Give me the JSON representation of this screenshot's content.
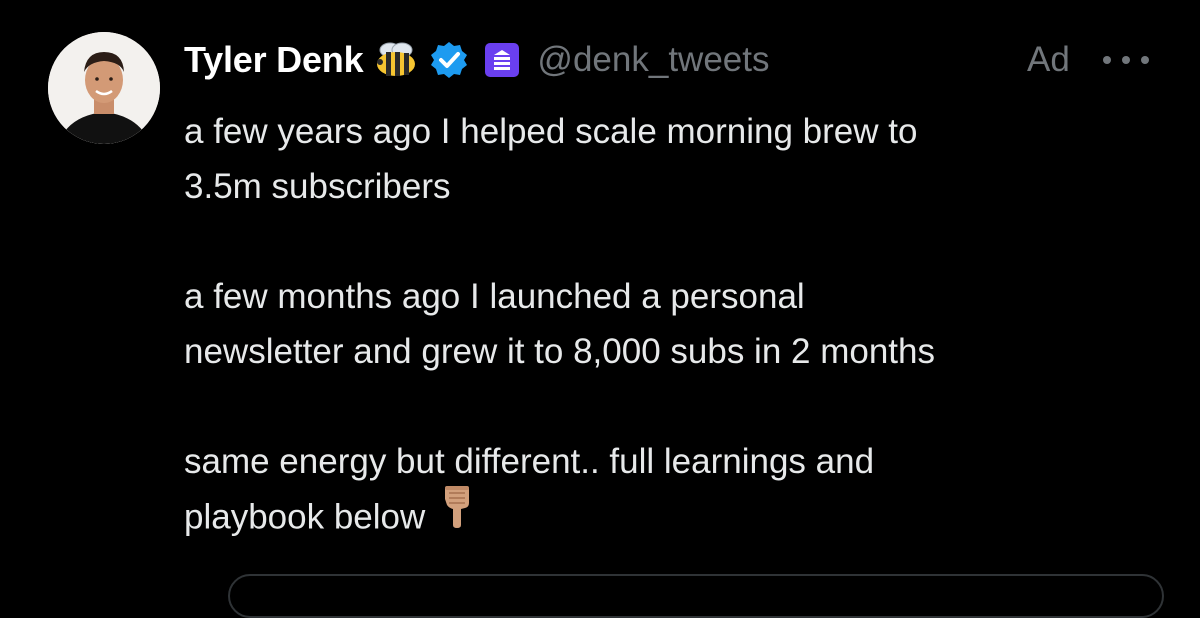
{
  "tweet": {
    "author": {
      "display_name": "Tyler Denk",
      "handle": "@denk_tweets",
      "avatar_icon": "profile-photo",
      "badges": [
        "bee-emoji-icon",
        "verified-badge-icon",
        "beehiiv-logo-icon"
      ]
    },
    "ad_label": "Ad",
    "more_icon": "more-options-icon",
    "paragraphs": [
      [
        "a few years ago I helped scale morning brew to",
        "3.5m subscribers"
      ],
      [
        "a few months ago I launched a personal",
        "newsletter and grew it to 8,000 subs in 2 months"
      ],
      [
        "same energy but different.. full learnings and",
        "playbook below"
      ]
    ],
    "trailing_emoji": "pointing-down-hand-icon"
  },
  "colors": {
    "background": "#000000",
    "name": "#ffffff",
    "text": "#e7e9ea",
    "secondary": "#71767b",
    "verified": "#1d9bf0",
    "beehiiv": "#6a3ff0"
  }
}
